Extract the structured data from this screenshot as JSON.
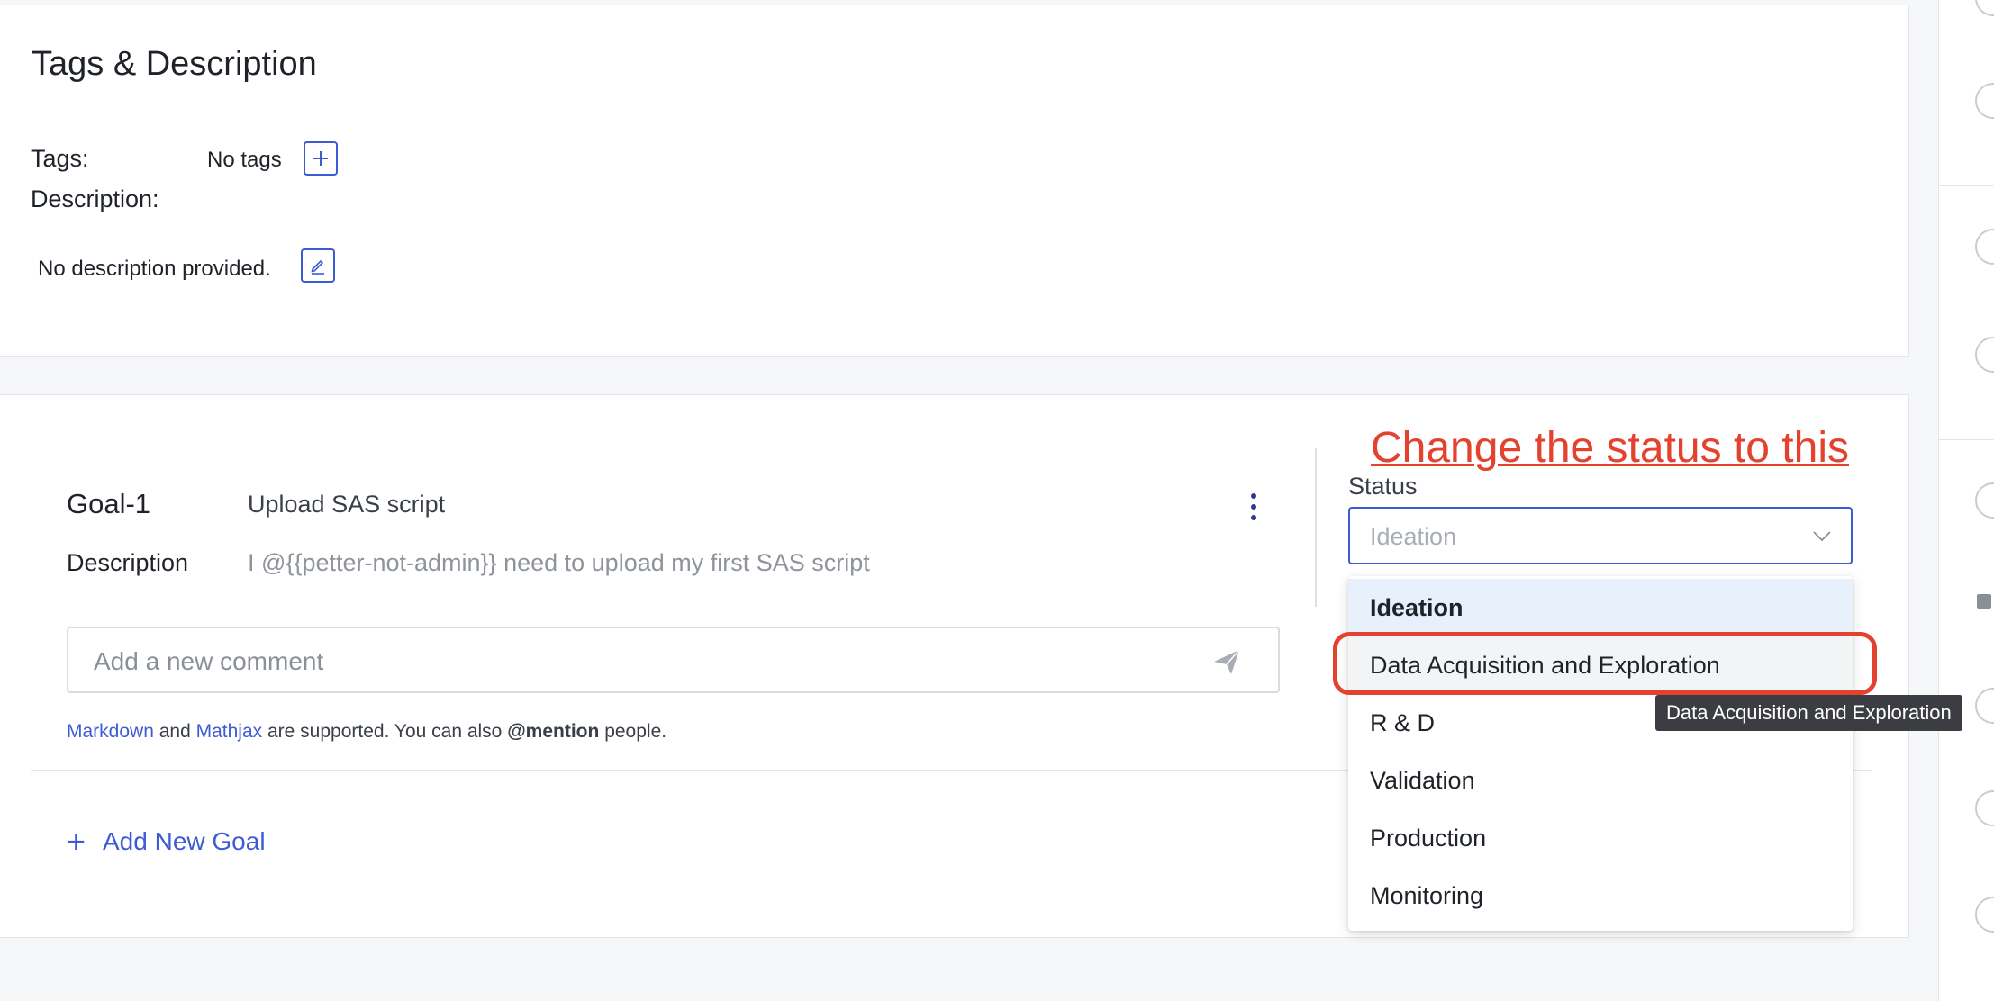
{
  "tags_section": {
    "title": "Tags & Description",
    "tags_label": "Tags:",
    "tags_value": "No tags",
    "description_label": "Description:",
    "description_value": "No description provided."
  },
  "goal": {
    "id": "Goal-1",
    "title": "Upload SAS script",
    "description_label": "Description",
    "description": "I @{{petter-not-admin}} need to upload my first SAS script",
    "comment_placeholder": "Add a new comment",
    "help": {
      "markdown": "Markdown",
      "and": "and",
      "mathjax": "Mathjax",
      "middle": "are supported. You can also",
      "mention": "@mention",
      "end": "people."
    },
    "add_goal_label": "Add New Goal"
  },
  "annotation": "Change the status to this",
  "status": {
    "label": "Status",
    "value": "Ideation",
    "options": [
      "Ideation",
      "Data Acquisition and Exploration",
      "R & D",
      "Validation",
      "Production",
      "Monitoring"
    ],
    "selected_index": 0,
    "hover_index": 1,
    "tooltip": "Data Acquisition and Exploration"
  },
  "colors": {
    "accent": "#3e5bd6",
    "annotation": "#e3432e"
  }
}
